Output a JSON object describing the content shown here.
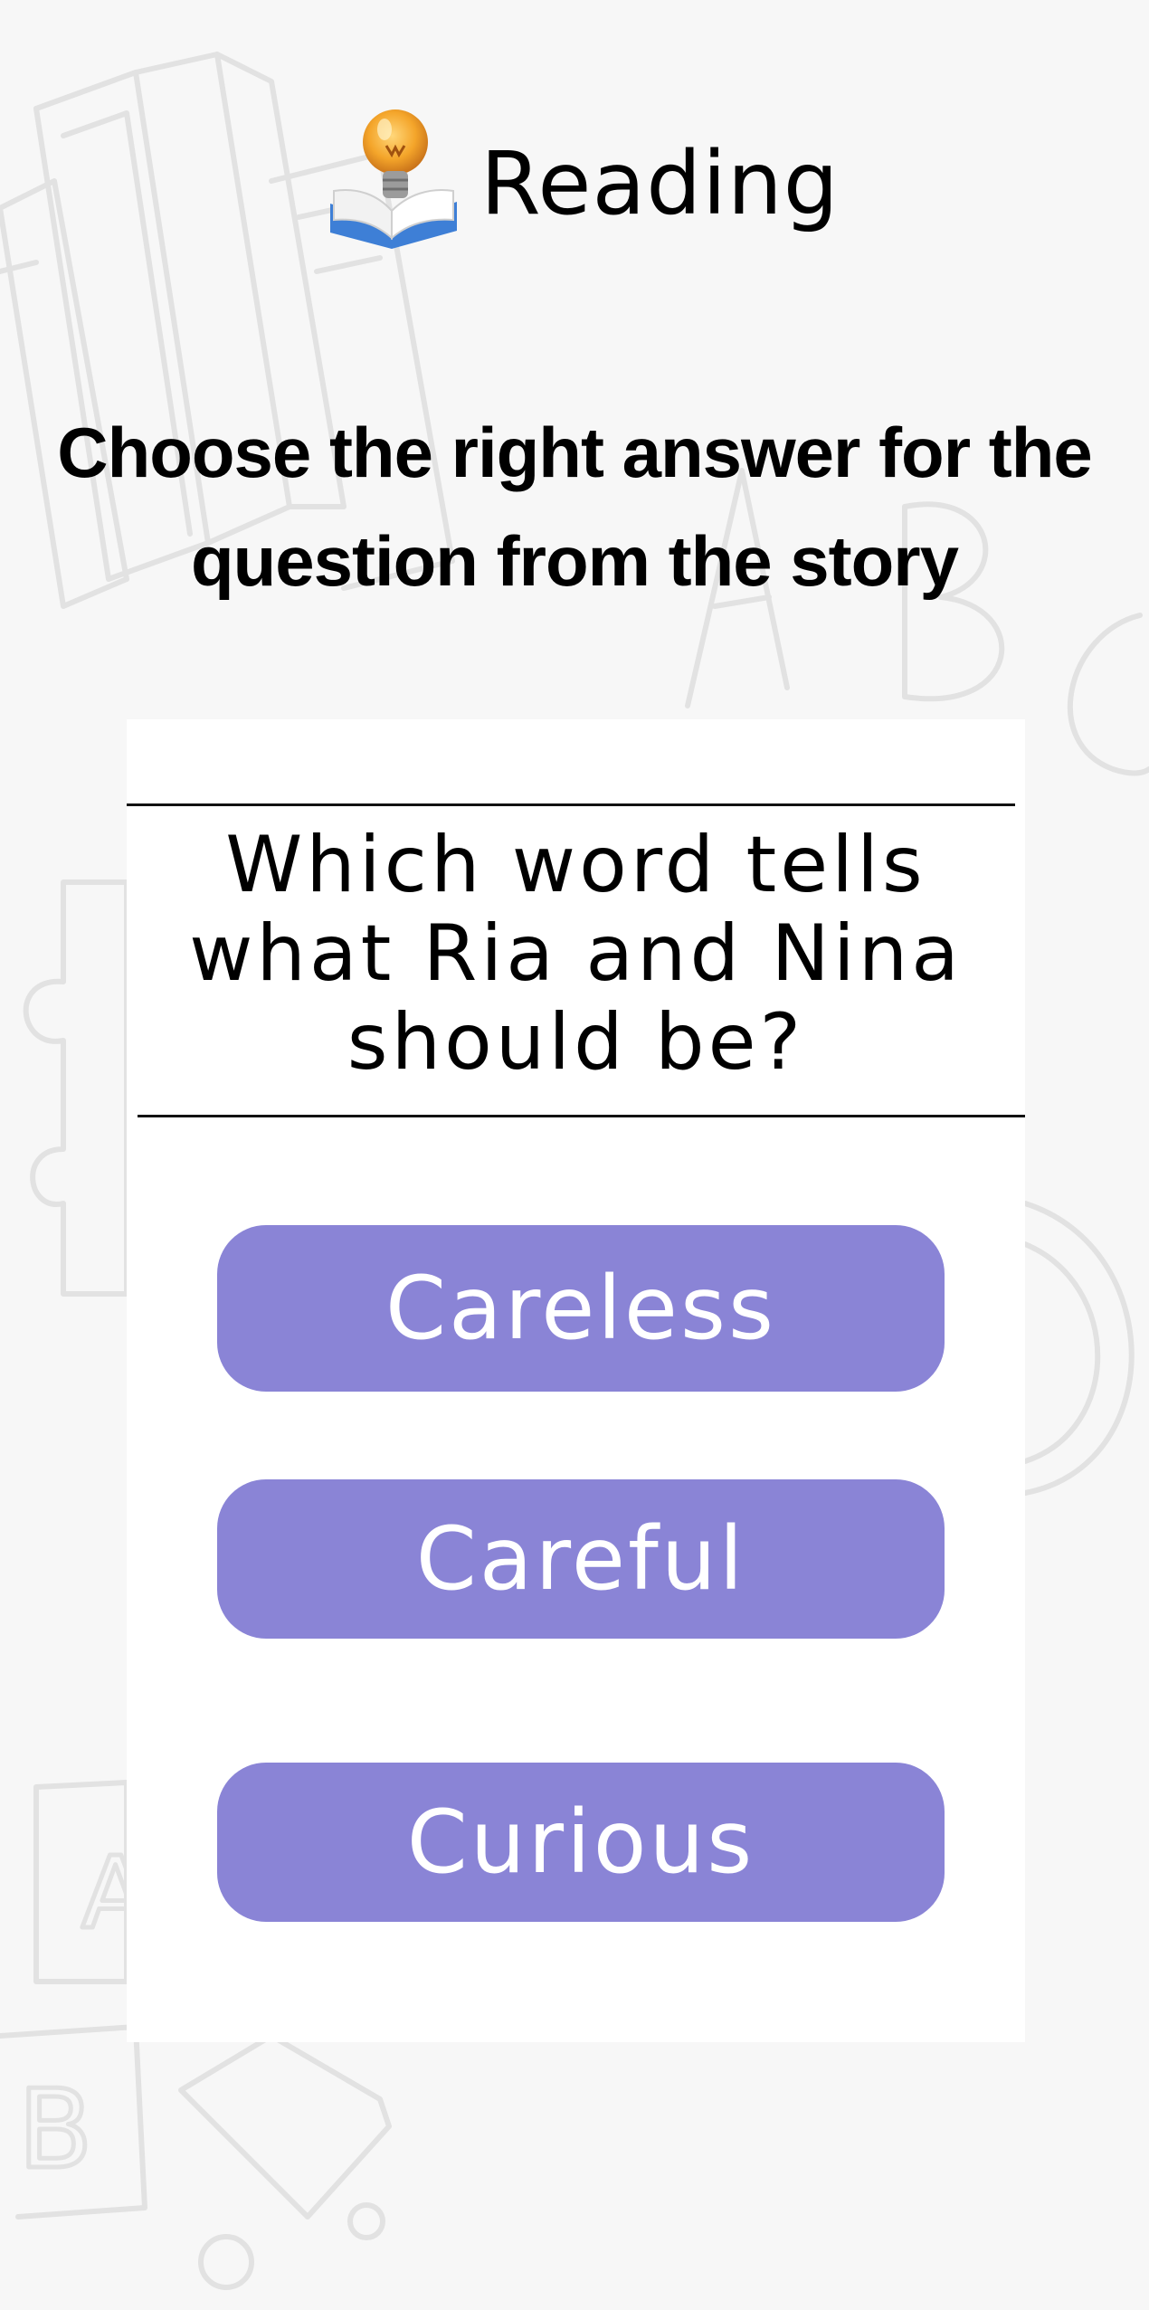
{
  "header": {
    "icon": "book-lightbulb-icon",
    "title": "Reading"
  },
  "instruction": "Choose the right answer for the question from the story",
  "question": {
    "text": "Which word tells what Ria and Nina should be?"
  },
  "answers": [
    {
      "label": "Careless"
    },
    {
      "label": "Careful"
    },
    {
      "label": "Curious"
    }
  ],
  "colors": {
    "background": "#f7f7f7",
    "card": "#ffffff",
    "answer_button": "#8a84d6",
    "answer_text": "#ffffff"
  }
}
